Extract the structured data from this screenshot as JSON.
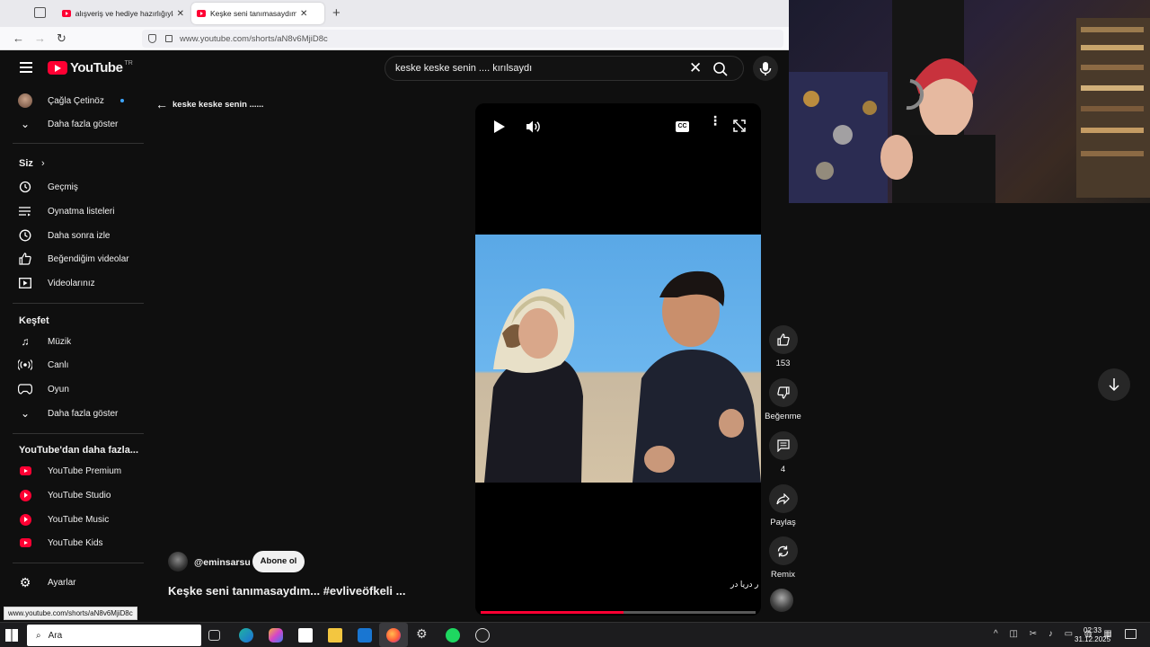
{
  "browser": {
    "tabs": [
      {
        "title": "alışveriş ve hediye hazırlığıyla gü",
        "active": false
      },
      {
        "title": "Keşke seni tanımasaydım... #evli",
        "active": true
      }
    ],
    "url": "www.youtube.com/shorts/aN8v6MjiD8c",
    "status_url": "www.youtube.com/shorts/aN8v6MjiD8c"
  },
  "header": {
    "logo_text": "YouTube",
    "logo_sup": "TR",
    "search_query": "keske keske senin .... kırılsaydı"
  },
  "sidebar": {
    "account": {
      "name": "Çağla Çetinöz"
    },
    "show_more_1": "Daha fazla göster",
    "you_heading": "Siz",
    "you_items": [
      {
        "label": "Geçmiş",
        "icon": "history-icon"
      },
      {
        "label": "Oynatma listeleri",
        "icon": "playlist-icon"
      },
      {
        "label": "Daha sonra izle",
        "icon": "clock-icon"
      },
      {
        "label": "Beğendiğim videolar",
        "icon": "thumb-up-icon"
      },
      {
        "label": "Videolarınız",
        "icon": "video-icon"
      }
    ],
    "explore_heading": "Keşfet",
    "explore_items": [
      {
        "label": "Müzik",
        "icon": "music-note-icon"
      },
      {
        "label": "Canlı",
        "icon": "live-icon"
      },
      {
        "label": "Oyun",
        "icon": "gamepad-icon"
      }
    ],
    "show_more_2": "Daha fazla göster",
    "more_heading": "YouTube'dan daha fazla...",
    "more_items": [
      {
        "label": "YouTube Premium",
        "icon": "youtube-premium-icon"
      },
      {
        "label": "YouTube Studio",
        "icon": "youtube-studio-icon"
      },
      {
        "label": "YouTube Music",
        "icon": "youtube-music-icon"
      },
      {
        "label": "YouTube Kids",
        "icon": "youtube-kids-icon"
      }
    ],
    "settings": "Ayarlar"
  },
  "shorts": {
    "back_title": "keske keske senin ......",
    "channel": "@eminsarsu",
    "subscribe": "Abone ol",
    "title": "Keşke seni tanımasaydım... #evliveöfkeli ...",
    "caption_overlay": "ر دریا در",
    "progress": 0.52
  },
  "actions": {
    "like_count": "153",
    "dislike_label": "Beğenme",
    "comment_count": "4",
    "share_label": "Paylaş",
    "remix_label": "Remix"
  },
  "taskbar": {
    "search_text": "Ara",
    "time": "02:33",
    "date": "31.12.2025"
  },
  "colors": {
    "accent": "#ff0033",
    "background": "#0f0f0f"
  }
}
